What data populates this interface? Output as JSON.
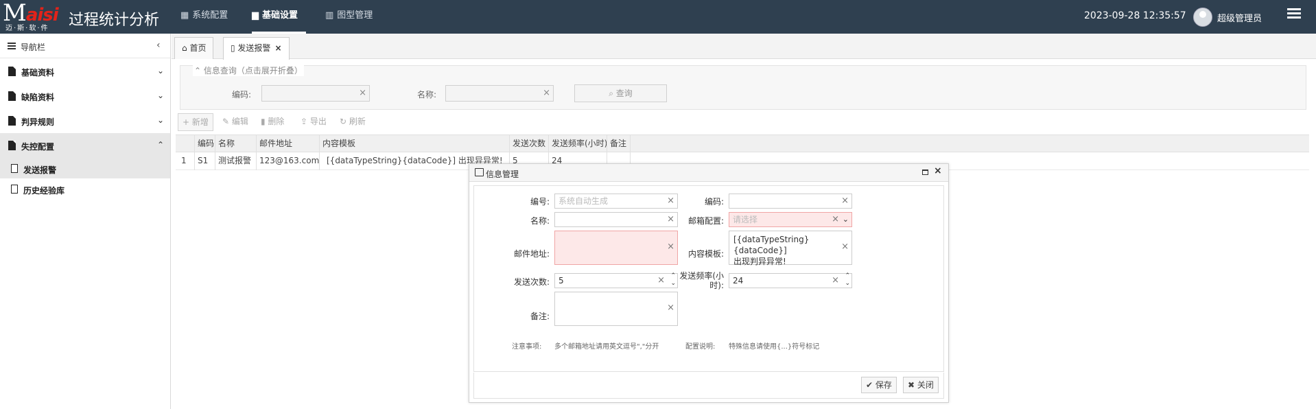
{
  "header": {
    "brand": "M",
    "brand_accent": "aisi",
    "brand_sub": "迈·斯·软·件",
    "app_title": "过程统计分析",
    "nav": [
      {
        "label": "系统配置",
        "icon": "windows-grid-icon"
      },
      {
        "label": "基础设置",
        "icon": "briefcase-icon"
      },
      {
        "label": "图型管理",
        "icon": "bar-chart-icon"
      }
    ],
    "datetime": "2023-09-28 12:35:57",
    "user": "超级管理员",
    "accent_color": "#2f4050"
  },
  "sidebar": {
    "title": "导航栏",
    "items": [
      {
        "label": "基础资料"
      },
      {
        "label": "缺陷资料"
      },
      {
        "label": "判异规则"
      },
      {
        "label": "失控配置"
      }
    ],
    "subitems": [
      {
        "label": "发送报警"
      },
      {
        "label": "历史经验库"
      }
    ]
  },
  "tabs": [
    {
      "label": "首页",
      "icon": "home-icon"
    },
    {
      "label": "发送报警",
      "icon": "file-icon"
    }
  ],
  "search": {
    "legend": "信息查询（点击展开折叠）",
    "code_label": "编码:",
    "name_label": "名称:",
    "query_label": "查询"
  },
  "toolbar": {
    "add": "新增",
    "edit": "编辑",
    "delete": "删除",
    "export": "导出",
    "refresh": "刷新"
  },
  "grid": {
    "columns": [
      "编码",
      "名称",
      "邮件地址",
      "内容模板",
      "发送次数",
      "发送频率(小时)",
      "备注"
    ],
    "rows": [
      {
        "index": "1",
        "code": "S1",
        "name": "测试报警",
        "email": "123@163.com",
        "template": "[{dataTypeString}{dataCode}] 出现异异常!",
        "count": "5",
        "freq": "24",
        "remark": ""
      }
    ]
  },
  "modal": {
    "title": "信息管理",
    "labels": {
      "number": "编号:",
      "code": "编码:",
      "name": "名称:",
      "mail_config": "邮箱配置:",
      "email": "邮件地址:",
      "template": "内容模板:",
      "count": "发送次数:",
      "freq_a": "发送频率(小",
      "freq_b": "时):",
      "remark": "备注:",
      "note_label": "注意事项:",
      "config_label": "配置说明:"
    },
    "values": {
      "number_placeholder": "系统自动生成",
      "mail_placeholder": "请选择",
      "template_line1": "[{dataTypeString} {dataCode}]",
      "template_line2": "出现判异异常!",
      "count": "5",
      "freq": "24"
    },
    "notes": {
      "note": "多个邮箱地址请用英文逗号\",\"分开",
      "config": "特殊信息请使用{...}符号标记"
    },
    "save": "保存",
    "close": "关闭"
  }
}
